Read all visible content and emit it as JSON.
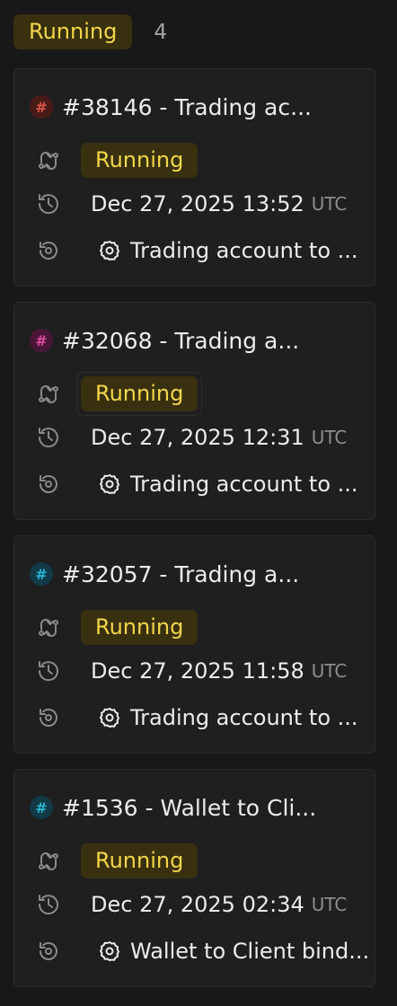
{
  "column": {
    "status_label": "Running",
    "count": "4"
  },
  "colors": {
    "running_bg": "#38300f",
    "running_text": "#f2d64b",
    "card_bg": "#1f1f1f",
    "page_bg": "#181818"
  },
  "cards": [
    {
      "title": "#38146 - Trading ac...",
      "badge_color": "#c0392b",
      "badge_bg": "#4a1a17",
      "status": "Running",
      "date": "Dec 27, 2025 13:52",
      "tz": "UTC",
      "flow": "Trading account to ...",
      "status_icon": "refresh-arrows-icon",
      "date_icon": "history-icon",
      "flow_row_icon": "replay-icon",
      "flow_icon": "gear-icon"
    },
    {
      "title": "#32068 - Trading a...",
      "badge_color": "#e04a9c",
      "badge_bg": "#4a1638",
      "status": "Running",
      "date": "Dec 27, 2025 12:31",
      "tz": "UTC",
      "flow": "Trading account to ...",
      "status_icon": "refresh-arrows-icon",
      "date_icon": "history-icon",
      "flow_row_icon": "replay-icon",
      "flow_icon": "gear-icon"
    },
    {
      "title": "#32057 - Trading a...",
      "badge_color": "#2bb5d6",
      "badge_bg": "#123a46",
      "status": "Running",
      "date": "Dec 27, 2025 11:58",
      "tz": "UTC",
      "flow": "Trading account to ...",
      "status_icon": "refresh-arrows-icon",
      "date_icon": "history-icon",
      "flow_row_icon": "replay-icon",
      "flow_icon": "gear-icon"
    },
    {
      "title": "#1536 - Wallet to Cli...",
      "badge_color": "#2bb5d6",
      "badge_bg": "#123a46",
      "status": "Running",
      "date": "Dec 27, 2025 02:34",
      "tz": "UTC",
      "flow": "Wallet to Client bind...",
      "status_icon": "refresh-arrows-icon",
      "date_icon": "history-icon",
      "flow_row_icon": "replay-icon",
      "flow_icon": "gear-icon"
    }
  ]
}
